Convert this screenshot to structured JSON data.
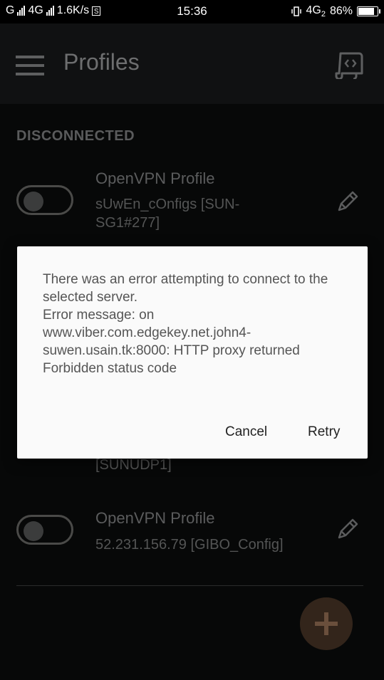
{
  "status_bar": {
    "carrier1": "G",
    "carrier2": "4G",
    "net_speed": "1.6K/s",
    "s_badge": "S",
    "time": "15:36",
    "network_type": "4G",
    "network_sub": "2",
    "battery": "86%",
    "battery_level": 0.86
  },
  "app_bar": {
    "title": "Profiles",
    "menu_icon": "hamburger-icon",
    "action_icon": "code-document-icon"
  },
  "list": {
    "section_header": "DISCONNECTED",
    "profiles": [
      {
        "name": "OpenVPN Profile",
        "detail": "sUwEn_cOnfigs [SUN-SG1#277]",
        "connected": false
      },
      {
        "name": "",
        "detail": "[SUNUDP1]",
        "connected": false
      },
      {
        "name": "OpenVPN Profile",
        "detail": "52.231.156.79 [GIBO_Config]",
        "connected": false
      }
    ],
    "fab_icon": "plus-icon"
  },
  "dialog": {
    "message": "There was an error attempting to connect to the selected server.\nError message: on www.viber.com.edgekey.net.john4-suwen.usain.tk:8000: HTTP proxy returned Forbidden status code",
    "cancel_label": "Cancel",
    "retry_label": "Retry"
  },
  "colors": {
    "background": "#070808",
    "app_bar": "#101112",
    "dialog": "#fafafa",
    "fab": "#33251b"
  }
}
